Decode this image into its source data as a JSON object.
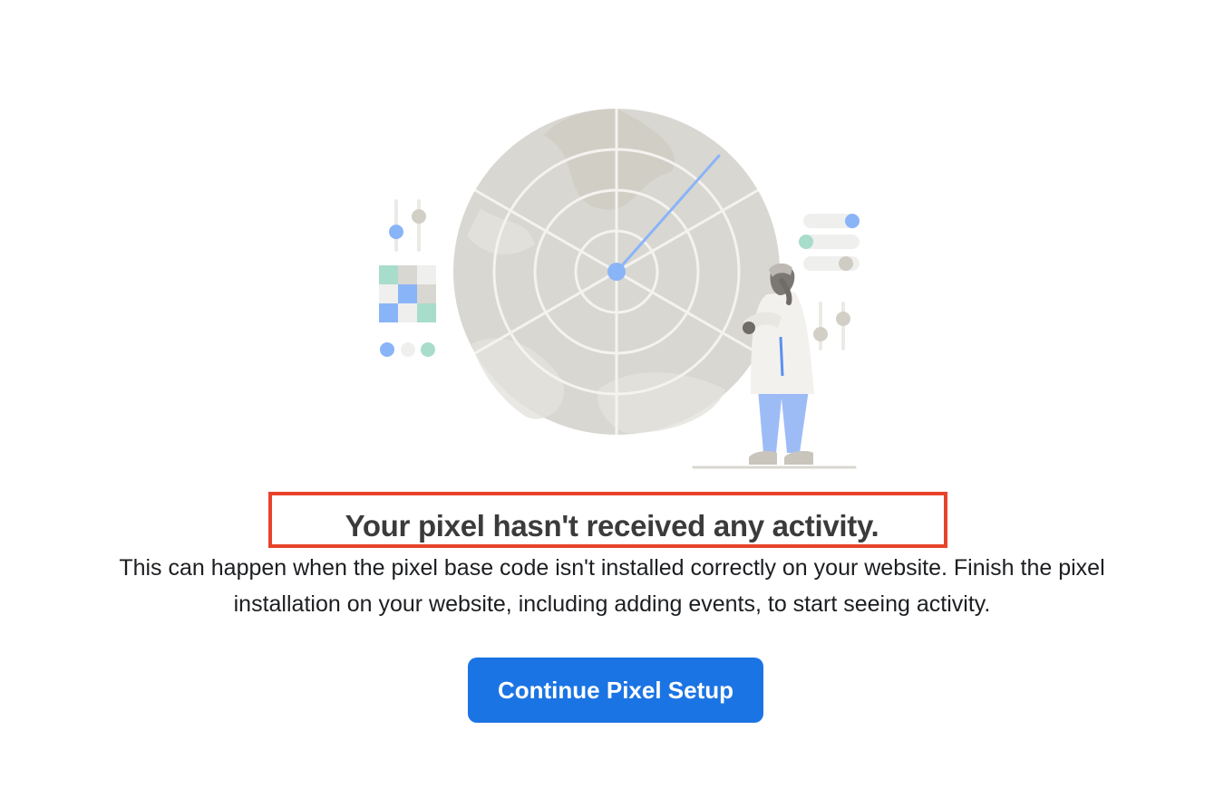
{
  "empty_state": {
    "headline": "Your pixel hasn't received any activity.",
    "description": "This can happen when the pixel base code isn't installed correctly on your website. Finish the pixel installation on your website, including adding events, to start seeing activity.",
    "cta_label": "Continue Pixel Setup",
    "highlight_color": "#e8432a",
    "cta_color": "#1b74e4"
  },
  "illustration": {
    "subject": "radar-with-scientist-illustration",
    "colors": {
      "radar": "#d9d7d1",
      "radar_lines": "#f4f3f0",
      "accent_blue": "#8ab4f8",
      "accent_green": "#a8dccb",
      "neutral": "#cfccc4"
    }
  }
}
